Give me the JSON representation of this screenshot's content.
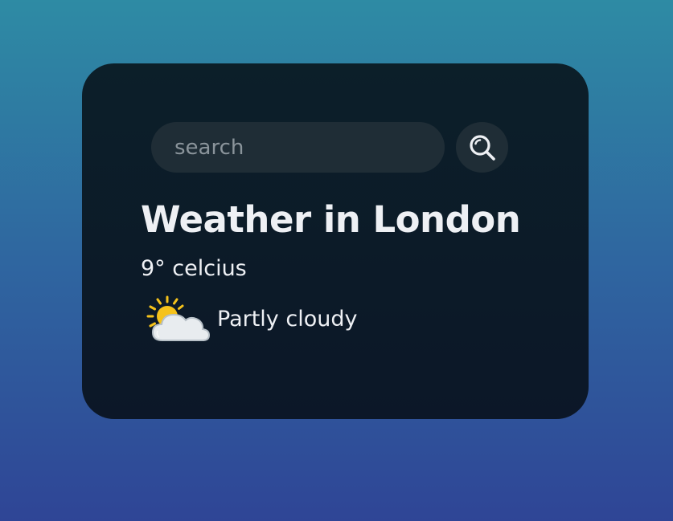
{
  "search": {
    "placeholder": "search",
    "value": ""
  },
  "weather": {
    "title": "Weather in London",
    "temperature": "9° celcius",
    "condition": "Partly cloudy",
    "condition_icon": "partly-cloudy-icon"
  },
  "icons": {
    "search_button": "search-icon"
  },
  "colors": {
    "card_bg": "#0c1c28",
    "input_bg": "#1f2d36",
    "text": "#eef0f4",
    "placeholder": "#8a949b",
    "sun": "#f5c21b",
    "cloud": "#e8ecef"
  }
}
